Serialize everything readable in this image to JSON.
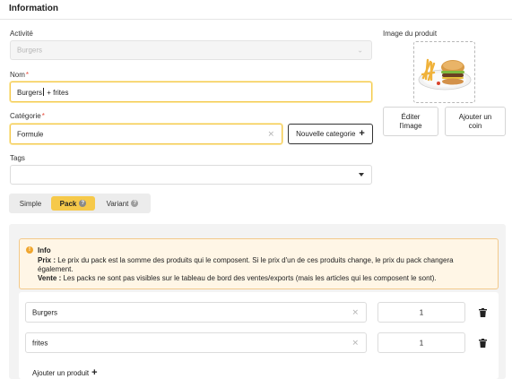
{
  "header": {
    "title": "Information"
  },
  "activite": {
    "label": "Activité",
    "value": "Burgers"
  },
  "nom": {
    "label": "Nom",
    "required_mark": "*",
    "value_before": "Burgers",
    "value_after": " + frites"
  },
  "categorie": {
    "label": "Catégorie",
    "required_mark": "*",
    "value": "Formule",
    "new_button": "Nouvelle categorie"
  },
  "tags": {
    "label": "Tags",
    "value": ""
  },
  "image": {
    "label": "Image du produit",
    "edit_button_line1": "Éditer",
    "edit_button_line2": "l'image",
    "corner_button_line1": "Ajouter un",
    "corner_button_line2": "coin"
  },
  "type_selector": {
    "options": [
      "Simple",
      "Pack",
      "Variant"
    ],
    "selected": "Pack",
    "help_glyph": "?"
  },
  "info_box": {
    "title": "Info",
    "prix_label": "Prix :",
    "prix_text_1": " Le prix du pack est la somme des produits qui le composent. Si le prix d'un de ces produits change, le prix du pack changera",
    "prix_text_2": "également.",
    "vente_label": "Vente :",
    "vente_text": " Les packs ne sont pas visibles sur le tableau de bord des ventes/exports (mais les articles qui les composent le sont)."
  },
  "pack_items": [
    {
      "product": "Burgers",
      "quantity": "1"
    },
    {
      "product": "frites",
      "quantity": "1"
    }
  ],
  "add_product": {
    "label": "Ajouter un produit"
  },
  "colors": {
    "accent": "#f6c94a",
    "focus_border": "#f4c84a",
    "info_bg": "#fff6e6",
    "info_border": "#f3c98a",
    "required": "#e74c3c"
  }
}
